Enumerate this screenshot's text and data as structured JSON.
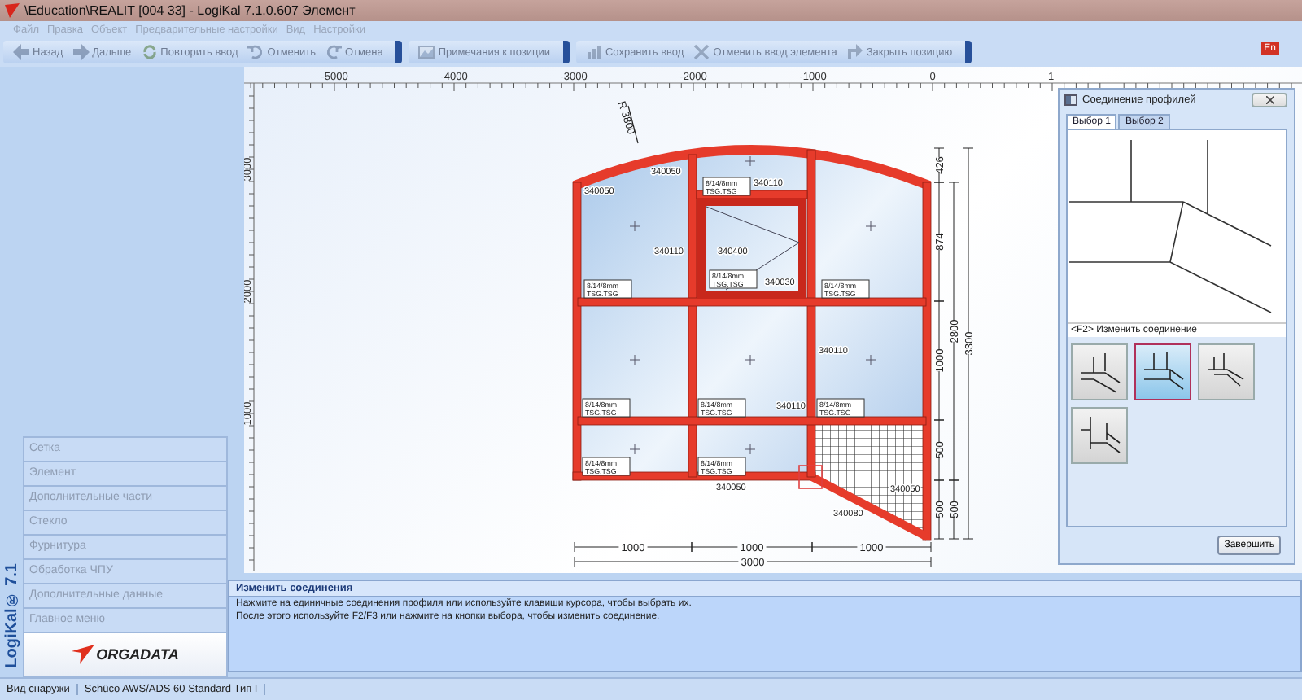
{
  "window": {
    "title": "\\Education\\REALIT [004 33] - LogiKal 7.1.0.607 Элемент"
  },
  "menu": [
    "Файл",
    "Правка",
    "Объект",
    "Предварительные настройки",
    "Вид",
    "Настройки"
  ],
  "toolbar_groups": [
    {
      "buttons": [
        {
          "label": "Назад",
          "kind": "back",
          "disabled": true
        },
        {
          "label": "Дальше",
          "kind": "forward",
          "disabled": true
        },
        {
          "label": "Повторить ввод",
          "kind": "repeat",
          "disabled": true
        },
        {
          "label": "Отменить",
          "kind": "undo",
          "disabled": true
        },
        {
          "label": "Отмена",
          "kind": "redo",
          "disabled": true
        }
      ]
    },
    {
      "buttons": [
        {
          "label": "Примечания к позиции",
          "kind": "notes",
          "disabled": true
        }
      ]
    },
    {
      "buttons": [
        {
          "label": "Сохранить ввод",
          "kind": "save",
          "disabled": true
        },
        {
          "label": "Отменить ввод элемента",
          "kind": "cancel",
          "disabled": true
        },
        {
          "label": "Закрыть позицию",
          "kind": "close",
          "disabled": true
        }
      ]
    }
  ],
  "language_badge": "En",
  "sidebar": {
    "product": "LogiKal® 7.1",
    "logo": "ORGADATA",
    "items": [
      {
        "label": "Сетка",
        "disabled": true
      },
      {
        "label": "Элемент",
        "disabled": true
      },
      {
        "label": "Дополнительные части",
        "disabled": true
      },
      {
        "label": "Стекло",
        "disabled": true
      },
      {
        "label": "Фурнитура",
        "disabled": true
      },
      {
        "label": "Обработка ЧПУ",
        "disabled": true
      },
      {
        "label": "Дополнительные данные",
        "disabled": true
      },
      {
        "label": "Главное меню",
        "disabled": true
      }
    ]
  },
  "ruler": {
    "x_labels": [
      "-5000",
      "-4000",
      "-3000",
      "-2000",
      "-1000",
      "0",
      "1"
    ],
    "y_labels": [
      "3000",
      "2000",
      "1000"
    ]
  },
  "drawing": {
    "radius_label": "R 3800",
    "glass_labels": [
      [
        "8/14/8mm",
        "TSG.TSG"
      ],
      [
        "8/14/8mm",
        "TSG.TSG"
      ],
      [
        "8/14/8mm",
        "TSG.TSG"
      ],
      [
        "8/14/8mm",
        "TSG.TSG"
      ],
      [
        "8/14/8mm",
        "TSG.TSG"
      ],
      [
        "8/14/8mm",
        "TSG.TSG"
      ],
      [
        "8/14/8mm",
        "TSG.TSG"
      ],
      [
        "8/14/8mm",
        "TSG.TSG"
      ],
      [
        "8/14/8mm",
        "TSG.TSG"
      ]
    ],
    "profile_labels": [
      "340050",
      "340050",
      "340110",
      "340110",
      "340400",
      "340030",
      "340110",
      "340110",
      "340050",
      "340050",
      "340080"
    ],
    "right_dimensions": [
      "426",
      "874",
      "1000",
      "500",
      "500",
      "2800",
      "500",
      "3300"
    ],
    "bottom_dimensions": [
      "1000",
      "1000",
      "1000",
      "3000"
    ]
  },
  "dialog": {
    "title": "Соединение профилей",
    "tabs": [
      {
        "label": "Выбор 1",
        "selected": true
      },
      {
        "label": "Выбор 2",
        "selected": false
      }
    ],
    "hint": "<F2> Изменить соединение",
    "options": [
      {
        "kind": "miter",
        "selected": false
      },
      {
        "kind": "butt",
        "selected": true
      },
      {
        "kind": "short",
        "selected": false
      },
      {
        "kind": "side",
        "selected": false
      }
    ],
    "finish_button": "Завершить"
  },
  "info_panel": {
    "title": "Изменить соединения",
    "lines": [
      "Нажмите на единичные соединения профиля или используйте клавиши курсора, чтобы выбрать их.",
      "После этого используйте F2/F3 или нажмите на кнопки выбора, чтобы изменить соединение."
    ]
  },
  "status_bar": [
    "Вид снаружи",
    "Schüco AWS/ADS 60 Standard Тип I"
  ]
}
